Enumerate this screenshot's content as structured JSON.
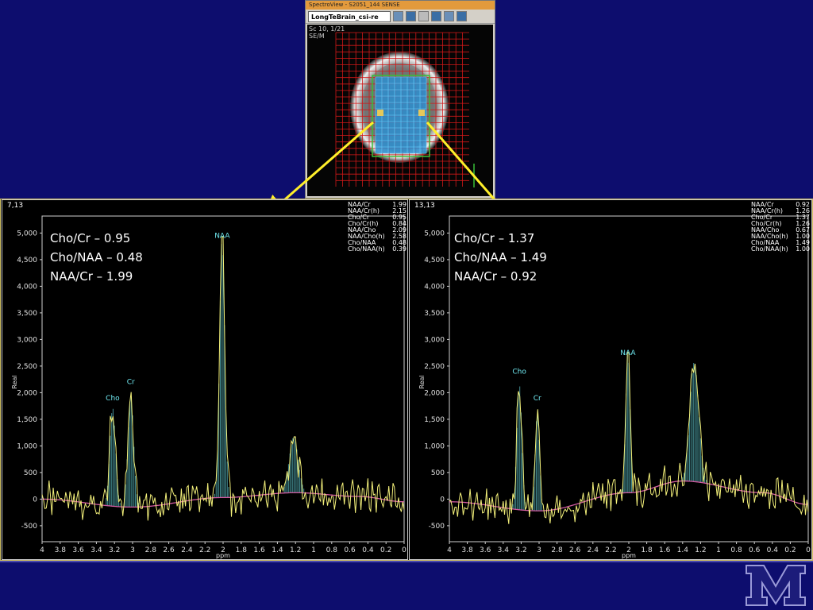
{
  "viewer": {
    "title": "SpectroView - S2051_144 SENSE",
    "dataset": "LongTeBrain_csi-re",
    "scan_info": [
      "Sc 10, 1/21",
      "SE/M"
    ]
  },
  "panels": [
    {
      "id": "left",
      "voxel": "7,13",
      "annotations": [
        "Cho/Cr – 0.95",
        "Cho/NAA – 0.48",
        "NAA/Cr – 1.99"
      ],
      "table": [
        {
          "name": "NAA/Cr",
          "value": "1.99"
        },
        {
          "name": "NAA/Cr(h)",
          "value": "2.15"
        },
        {
          "name": "Cho/Cr",
          "value": "0.95"
        },
        {
          "name": "Cho/Cr(h)",
          "value": "0.84"
        },
        {
          "name": "NAA/Cho",
          "value": "2.09"
        },
        {
          "name": "NAA/Cho(h)",
          "value": "2.58"
        },
        {
          "name": "Cho/NAA",
          "value": "0.48"
        },
        {
          "name": "Cho/NAA(h)",
          "value": "0.39"
        }
      ]
    },
    {
      "id": "right",
      "voxel": "13,13",
      "annotations": [
        "Cho/Cr – 1.37",
        "Cho/NAA – 1.49",
        "NAA/Cr – 0.92"
      ],
      "table": [
        {
          "name": "NAA/Cr",
          "value": "0.92"
        },
        {
          "name": "NAA/Cr(h)",
          "value": "1.26"
        },
        {
          "name": "Cho/Cr",
          "value": "1.37"
        },
        {
          "name": "Cho/Cr(h)",
          "value": "1.26"
        },
        {
          "name": "NAA/Cho",
          "value": "0.67"
        },
        {
          "name": "NAA/Cho(h)",
          "value": "1.00"
        },
        {
          "name": "Cho/NAA",
          "value": "1.49"
        },
        {
          "name": "Cho/NAA(h)",
          "value": "1.00"
        }
      ]
    }
  ],
  "chart_data": [
    {
      "type": "line",
      "xlabel": "ppm",
      "ylabel": "Real",
      "xlim": [
        4,
        0
      ],
      "ylim": [
        -800,
        5200
      ],
      "x_ticks": [
        "4",
        "3.8",
        "3.6",
        "3.4",
        "3.2",
        "3",
        "2.8",
        "2.6",
        "2.4",
        "2.2",
        "2",
        "1.8",
        "1.6",
        "1.4",
        "1.2",
        "1",
        "0.8",
        "0.6",
        "0.4",
        "0.2",
        "0"
      ],
      "y_ticks": [
        "5,000",
        "4,500",
        "4,000",
        "3,500",
        "3,000",
        "2,500",
        "2,000",
        "1,500",
        "1,000",
        "500",
        "0",
        "-500"
      ],
      "peak_labels": [
        {
          "label": "Cho",
          "ppm": 3.22,
          "y": 1800
        },
        {
          "label": "Cr",
          "ppm": 3.02,
          "y": 2100
        },
        {
          "label": "NAA",
          "ppm": 2.01,
          "y": 4850
        }
      ],
      "baseline_points": [
        [
          4,
          0
        ],
        [
          3.0,
          -150
        ],
        [
          2.0,
          30
        ],
        [
          1.2,
          120
        ],
        [
          0.5,
          50
        ],
        [
          0,
          -50
        ]
      ],
      "peaks": [
        [
          3.22,
          1850,
          0.045
        ],
        [
          3.02,
          2100,
          0.045
        ],
        [
          2.01,
          4850,
          0.04
        ],
        [
          1.22,
          1050,
          0.07
        ]
      ],
      "colors": {
        "spectrum": "#f3f07a",
        "fit": "#6fe8f0",
        "baseline": "#d25aa0"
      }
    },
    {
      "type": "line",
      "xlabel": "ppm",
      "ylabel": "Real",
      "xlim": [
        4,
        0
      ],
      "ylim": [
        -800,
        5200
      ],
      "x_ticks": [
        "4",
        "3.8",
        "3.6",
        "3.4",
        "3.2",
        "3",
        "2.8",
        "2.6",
        "2.4",
        "2.2",
        "2",
        "1.8",
        "1.6",
        "1.4",
        "1.2",
        "1",
        "0.8",
        "0.6",
        "0.4",
        "0.2",
        "0"
      ],
      "y_ticks": [
        "5,000",
        "4,500",
        "4,000",
        "3,500",
        "3,000",
        "2,500",
        "2,000",
        "1,500",
        "1,000",
        "500",
        "0",
        "-500"
      ],
      "peak_labels": [
        {
          "label": "Cho",
          "ppm": 3.22,
          "y": 2300
        },
        {
          "label": "Cr",
          "ppm": 3.02,
          "y": 1800
        },
        {
          "label": "NAA",
          "ppm": 2.01,
          "y": 2650
        }
      ],
      "baseline_points": [
        [
          4,
          -50
        ],
        [
          3.0,
          -220
        ],
        [
          2.0,
          120
        ],
        [
          1.4,
          340
        ],
        [
          0.5,
          120
        ],
        [
          0,
          -100
        ]
      ],
      "peaks": [
        [
          3.22,
          2350,
          0.04
        ],
        [
          3.02,
          1850,
          0.035
        ],
        [
          2.01,
          2650,
          0.035
        ],
        [
          1.27,
          2250,
          0.07
        ]
      ],
      "colors": {
        "spectrum": "#f3f07a",
        "fit": "#6fe8f0",
        "baseline": "#d25aa0"
      }
    }
  ]
}
